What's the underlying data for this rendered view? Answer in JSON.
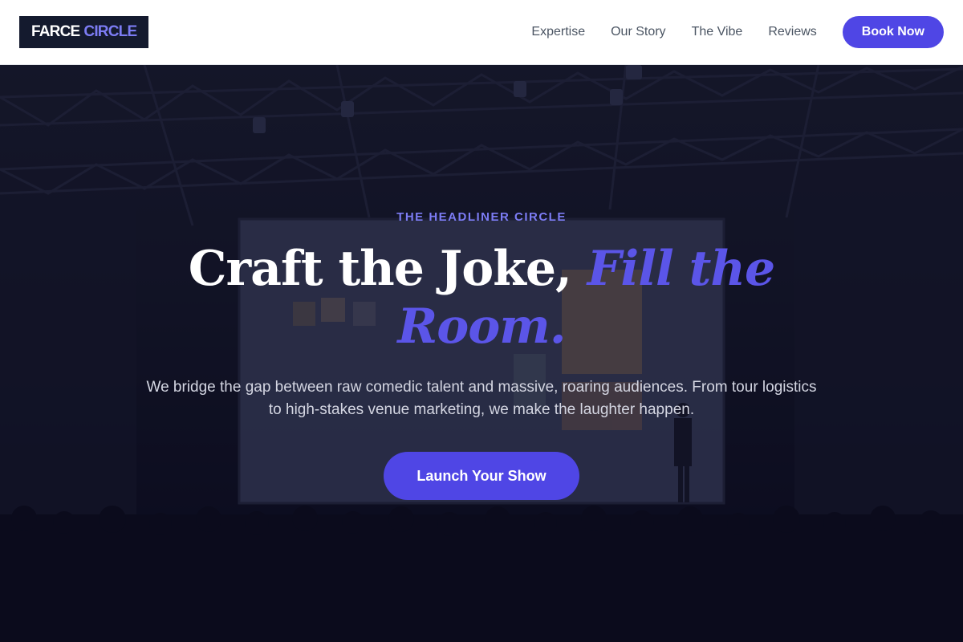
{
  "header": {
    "logo_word1": "FARCE",
    "logo_word2": "CIRCLE",
    "nav": [
      {
        "label": "Expertise"
      },
      {
        "label": "Our Story"
      },
      {
        "label": "The Vibe"
      },
      {
        "label": "Reviews"
      }
    ],
    "cta_label": "Book Now"
  },
  "hero": {
    "eyebrow": "THE HEADLINER CIRCLE",
    "headline_plain": "Craft the Joke, ",
    "headline_accent": "Fill the Room.",
    "subtext": "We bridge the gap between raw comedic talent and massive, roaring audiences. From tour logistics to high-stakes venue marketing, we make the laughter happen.",
    "cta_label": "Launch Your Show"
  },
  "colors": {
    "accent": "#4f46e5",
    "accent_light": "#7c7cf4",
    "logo_bg": "#141a2e",
    "nav_text": "#4b5563"
  }
}
